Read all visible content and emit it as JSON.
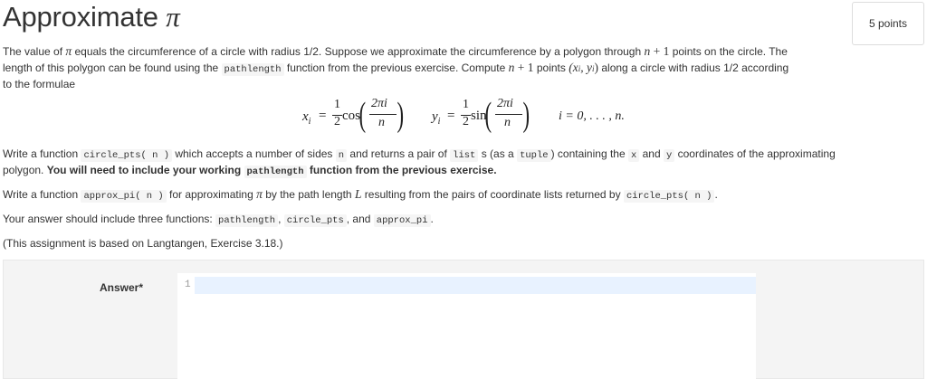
{
  "header": {
    "title_text": "Approximate ",
    "title_pi": "π",
    "points": "5 points"
  },
  "para1": {
    "l1a": "The value of ",
    "l1pi": "π",
    "l1b": " equals the circumference of a circle with radius 1/2. Suppose we approximate the circumference by a polygon through ",
    "l1n": "n",
    "l1plus": " + 1",
    "l1c": " points on the circle. The",
    "l2a": "length of this polygon can be found using the ",
    "l2code": "pathlength",
    "l2b": " function from the previous exercise. Compute ",
    "l2n": "n",
    "l2plus": " + 1",
    "l2c": " points ",
    "l2xy": "(x",
    "l2i1": "i",
    "l2comma": ", y",
    "l2i2": "i",
    "l2close": ")",
    "l2d": " along a circle with radius 1/2 according",
    "l3": "to the formulae"
  },
  "formula": {
    "x": "x",
    "y": "y",
    "i": "i",
    "eq": "=",
    "one": "1",
    "two": "2",
    "cos": "cos",
    "sin": "sin",
    "num": "2πi",
    "den": "n",
    "range": "i = 0, . . . , n."
  },
  "para2": {
    "a": "Write a function ",
    "code1": "circle_pts( n )",
    "b": " which accepts a number of sides ",
    "code2": "n",
    "c": " and returns a pair of ",
    "code3": "list",
    "d": " s (as a ",
    "code4": "tuple",
    "e": ") containing the ",
    "code5": "x",
    "f": " and ",
    "code6": "y",
    "g": " coordinates of the approximating",
    "h": "polygon. ",
    "bold1": "You will need to include your working ",
    "boldcode": "pathlength",
    "bold2": " function from the previous exercise."
  },
  "para3": {
    "a": "Write a function ",
    "code1": "approx_pi( n )",
    "b": " for approximating ",
    "pi": "π",
    "c": " by the path length ",
    "L": "L",
    "d": " resulting from the pairs of coordinate lists returned by ",
    "code2": "circle_pts( n )",
    "e": "."
  },
  "para4": {
    "a": "Your answer should include three functions: ",
    "code1": "pathlength",
    "b": ", ",
    "code2": "circle_pts",
    "c": ", and ",
    "code3": "approx_pi",
    "d": "."
  },
  "para5": {
    "text": "(This assignment is based on Langtangen, Exercise 3.18.)"
  },
  "answer": {
    "label": "Answer",
    "required_mark": "*",
    "line_number": "1"
  }
}
